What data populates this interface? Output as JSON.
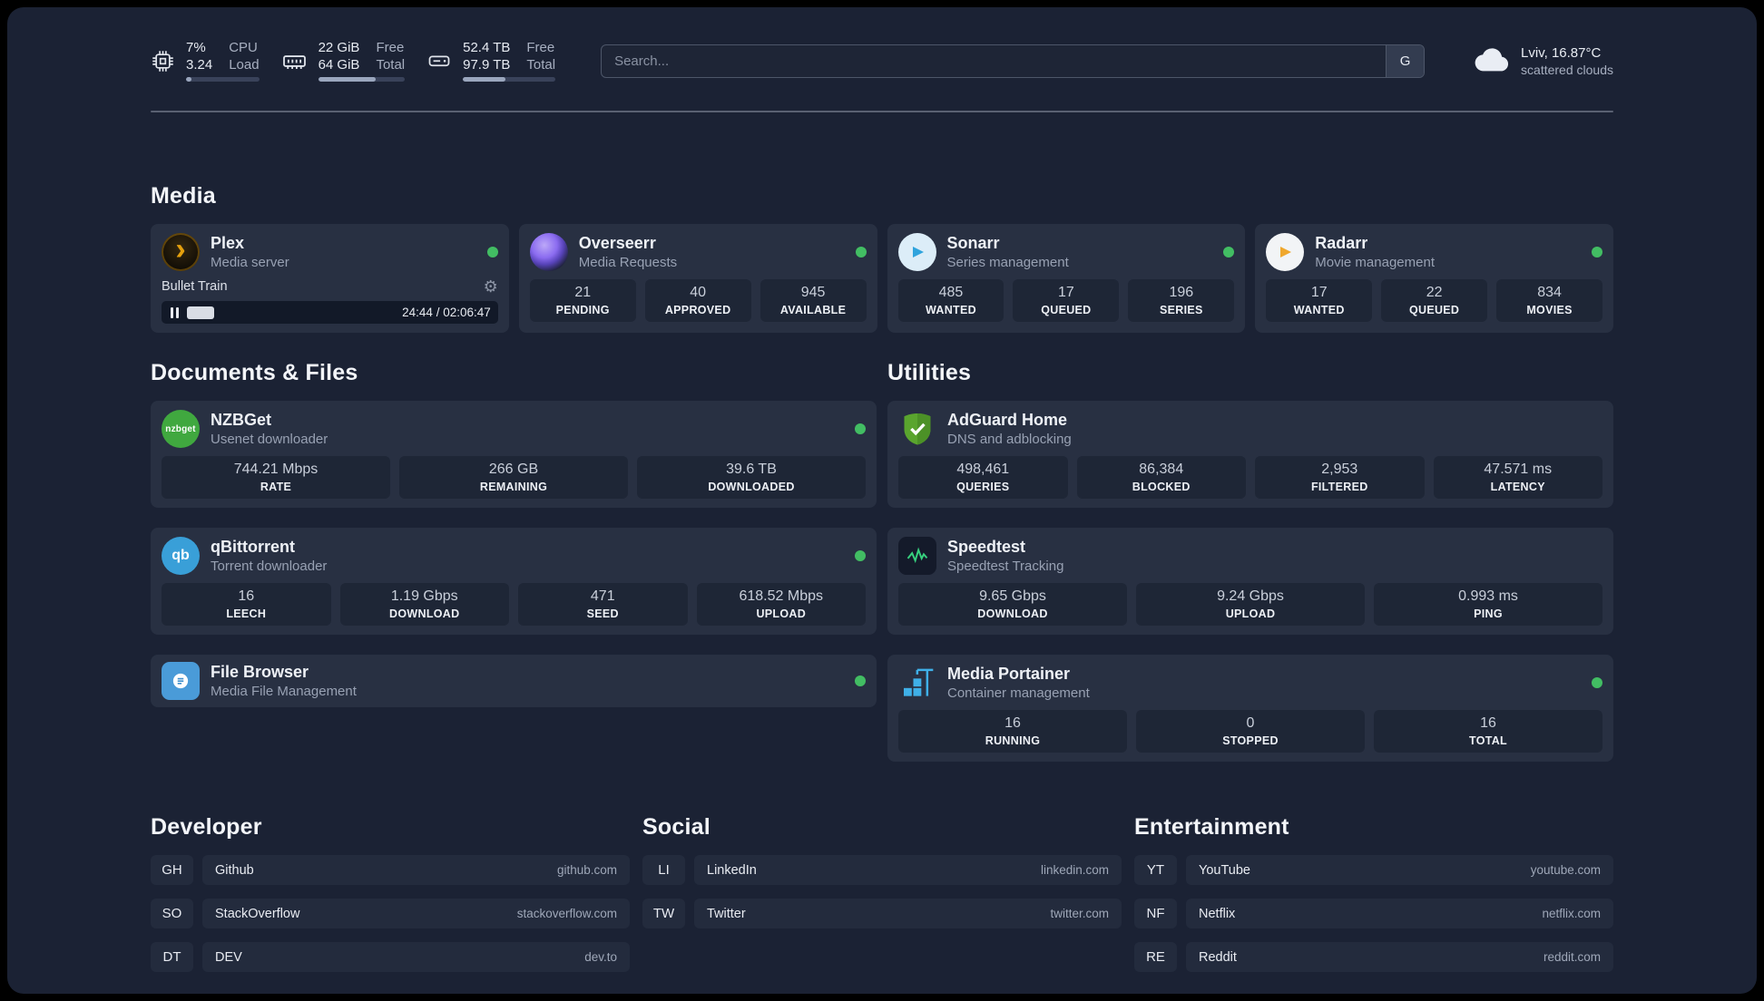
{
  "colors": {
    "status_online": "#42bd63",
    "accent_green": "#37d07e"
  },
  "icons": {
    "plex_glyph": "›",
    "gear": "⚙",
    "qbittorrent_glyph": "qb",
    "nzbget_glyph": "nzbget"
  },
  "topbar": {
    "cpu": {
      "value_top": "7%",
      "label_top": "CPU",
      "value_bottom": "3.24",
      "label_bottom": "Load",
      "bar": "7%"
    },
    "ram": {
      "value_top": "22 GiB",
      "label_top": "Free",
      "value_bottom": "64 GiB",
      "label_bottom": "Total",
      "bar": "66%"
    },
    "disk": {
      "value_top": "52.4 TB",
      "label_top": "Free",
      "value_bottom": "97.9 TB",
      "label_bottom": "Total",
      "bar": "46%"
    },
    "search": {
      "placeholder": "Search...",
      "button_label": "G"
    },
    "weather": {
      "location": "Lviv, 16.87°C",
      "condition": "scattered clouds"
    }
  },
  "media": {
    "title": "Media",
    "plex": {
      "name": "Plex",
      "subtitle": "Media server",
      "now_playing": "Bullet Train",
      "elapsed_total": "24:44 / 02:06:47",
      "progress": "13%"
    },
    "overseerr": {
      "name": "Overseerr",
      "subtitle": "Media Requests",
      "stats": [
        {
          "value": "21",
          "label": "PENDING"
        },
        {
          "value": "40",
          "label": "APPROVED"
        },
        {
          "value": "945",
          "label": "AVAILABLE"
        }
      ]
    },
    "sonarr": {
      "name": "Sonarr",
      "subtitle": "Series management",
      "stats": [
        {
          "value": "485",
          "label": "WANTED"
        },
        {
          "value": "17",
          "label": "QUEUED"
        },
        {
          "value": "196",
          "label": "SERIES"
        }
      ]
    },
    "radarr": {
      "name": "Radarr",
      "subtitle": "Movie management",
      "stats": [
        {
          "value": "17",
          "label": "WANTED"
        },
        {
          "value": "22",
          "label": "QUEUED"
        },
        {
          "value": "834",
          "label": "MOVIES"
        }
      ]
    }
  },
  "documents": {
    "title": "Documents & Files",
    "nzbget": {
      "name": "NZBGet",
      "subtitle": "Usenet downloader",
      "stats": [
        {
          "value": "744.21 Mbps",
          "label": "RATE"
        },
        {
          "value": "266 GB",
          "label": "REMAINING"
        },
        {
          "value": "39.6 TB",
          "label": "DOWNLOADED"
        }
      ]
    },
    "qbittorrent": {
      "name": "qBittorrent",
      "subtitle": "Torrent downloader",
      "stats": [
        {
          "value": "16",
          "label": "LEECH"
        },
        {
          "value": "1.19 Gbps",
          "label": "DOWNLOAD"
        },
        {
          "value": "471",
          "label": "SEED"
        },
        {
          "value": "618.52 Mbps",
          "label": "UPLOAD"
        }
      ]
    },
    "filebrowser": {
      "name": "File Browser",
      "subtitle": "Media File Management"
    }
  },
  "utilities": {
    "title": "Utilities",
    "adguard": {
      "name": "AdGuard Home",
      "subtitle": "DNS and adblocking",
      "stats": [
        {
          "value": "498,461",
          "label": "QUERIES"
        },
        {
          "value": "86,384",
          "label": "BLOCKED"
        },
        {
          "value": "2,953",
          "label": "FILTERED"
        },
        {
          "value": "47.571 ms",
          "label": "LATENCY"
        }
      ]
    },
    "speedtest": {
      "name": "Speedtest",
      "subtitle": "Speedtest Tracking",
      "stats": [
        {
          "value": "9.65 Gbps",
          "label": "DOWNLOAD"
        },
        {
          "value": "9.24 Gbps",
          "label": "UPLOAD"
        },
        {
          "value": "0.993 ms",
          "label": "PING"
        }
      ]
    },
    "portainer": {
      "name": "Media Portainer",
      "subtitle": "Container management",
      "stats": [
        {
          "value": "16",
          "label": "RUNNING"
        },
        {
          "value": "0",
          "label": "STOPPED"
        },
        {
          "value": "16",
          "label": "TOTAL"
        }
      ]
    }
  },
  "bookmarks": {
    "developer": {
      "title": "Developer",
      "items": [
        {
          "abbr": "GH",
          "name": "Github",
          "url": "github.com"
        },
        {
          "abbr": "SO",
          "name": "StackOverflow",
          "url": "stackoverflow.com"
        },
        {
          "abbr": "DT",
          "name": "DEV",
          "url": "dev.to"
        }
      ]
    },
    "social": {
      "title": "Social",
      "items": [
        {
          "abbr": "LI",
          "name": "LinkedIn",
          "url": "linkedin.com"
        },
        {
          "abbr": "TW",
          "name": "Twitter",
          "url": "twitter.com"
        }
      ]
    },
    "entertainment": {
      "title": "Entertainment",
      "items": [
        {
          "abbr": "YT",
          "name": "YouTube",
          "url": "youtube.com"
        },
        {
          "abbr": "NF",
          "name": "Netflix",
          "url": "netflix.com"
        },
        {
          "abbr": "RE",
          "name": "Reddit",
          "url": "reddit.com"
        }
      ]
    }
  }
}
